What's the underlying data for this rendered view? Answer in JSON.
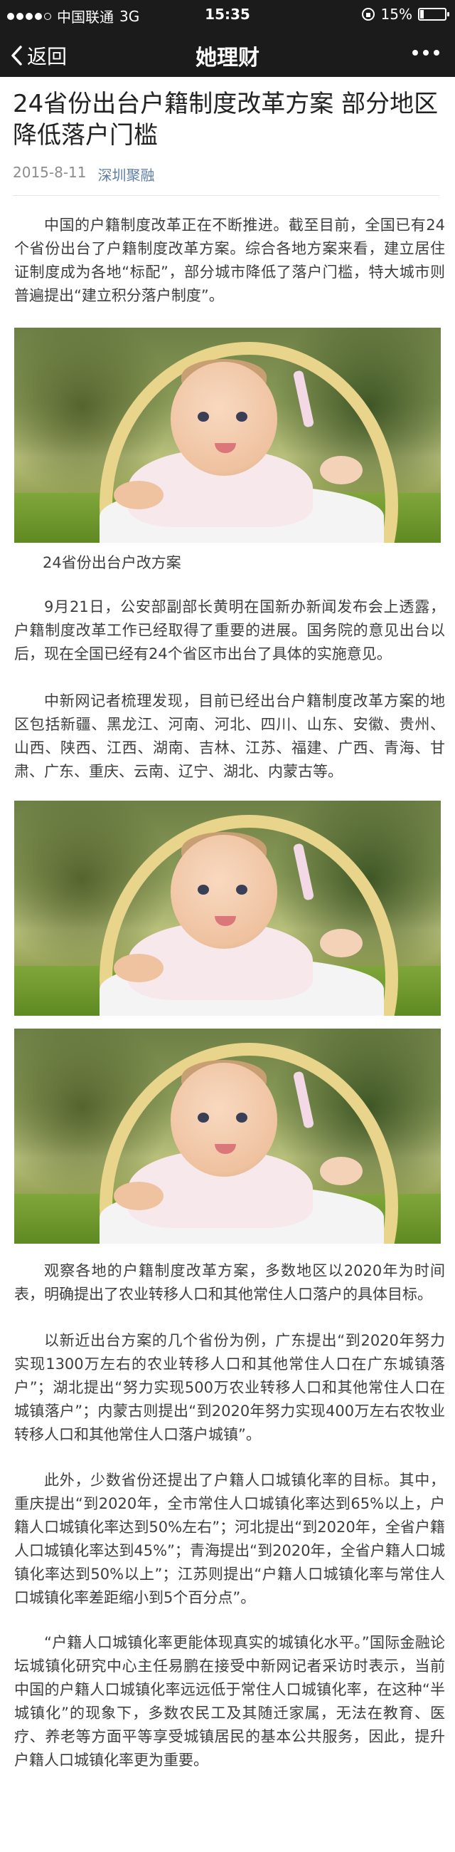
{
  "status_bar": {
    "carrier": "中国联通",
    "network": "3G",
    "time": "15:35",
    "battery_text": "15%",
    "battery_level": 0.15
  },
  "nav": {
    "back_label": "返回",
    "title": "她理财"
  },
  "article": {
    "title": "24省份出台户籍制度改革方案 部分地区降低落户门槛",
    "date": "2015-8-11",
    "source": "深圳聚融",
    "paragraphs": [
      "中国的户籍制度改革正在不断推进。截至目前，全国已有24个省份出台了户籍制度改革方案。综合各地方案来看，建立居住证制度成为各地“标配”，部分城市降低了落户门槛，特大城市则普遍提出“建立积分落户制度”。",
      "9月21日，公安部副部长黄明在国新办新闻发布会上透露，户籍制度改革工作已经取得了重要的进展。国务院的意见出台以后，现在全国已经有24个省区市出台了具体的实施意见。",
      "中新网记者梳理发现，目前已经出台户籍制度改革方案的地区包括新疆、黑龙江、河南、河北、四川、山东、安徽、贵州、山西、陕西、江西、湖南、吉林、江苏、福建、广西、青海、甘肃、广东、重庆、云南、辽宁、湖北、内蒙古等。",
      "观察各地的户籍制度改革方案，多数地区以2020年为时间表，明确提出了农业转移人口和其他常住人口落户的具体目标。",
      "以新近出台方案的几个省份为例，广东提出“到2020年努力实现1300万左右的农业转移人口和其他常住人口在广东城镇落户”；湖北提出“努力实现500万农业转移人口和其他常住人口在城镇落户”；内蒙古则提出“到2020年努力实现400万左右农牧业转移人口和其他常住人口落户城镇”。",
      "此外，少数省份还提出了户籍人口城镇化率的目标。其中，重庆提出“到2020年，全市常住人口城镇化率达到65%以上，户籍人口城镇化率达到50%左右”；河北提出“到2020年，全省户籍人口城镇化率达到45%”；青海提出“到2020年，全省户籍人口城镇化率达到50%以上”；江苏则提出“户籍人口城镇化率与常住人口城镇化率差距缩小到5个百分点”。",
      "“户籍人口城镇化率更能体现真实的城镇化水平。”国际金融论坛城镇化研究中心主任易鹏在接受中新网记者采访时表示，当前中国的户籍人口城镇化率远远低于常住人口城镇化率，在这种“半城镇化”的现象下，多数农民工及其随迁家属，无法在教育、医疗、养老等方面平等享受城镇居民的基本公共服务，因此，提升户籍人口城镇化率更为重要。"
    ],
    "caption": "24省份出台户改方案"
  }
}
